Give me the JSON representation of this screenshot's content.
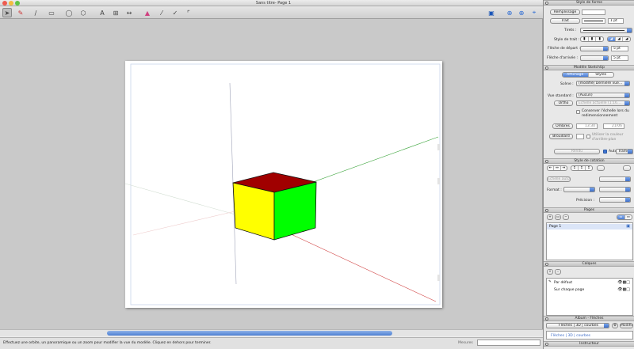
{
  "window": {
    "title": "Sans titre- Page 1"
  },
  "colors": {
    "close": "#ee5b50",
    "minimize": "#f2bc3f",
    "zoom": "#5fc546",
    "cube_top": "#a00000",
    "cube_left": "#ffff00",
    "cube_right": "#00ff00"
  },
  "toolbar": {
    "tools": [
      "select-arrow-icon",
      "pencil-icon",
      "line-icon",
      "rectangle-icon",
      "circle-icon",
      "polygon-icon",
      "text-icon",
      "label-icon",
      "dimension-icon",
      "eraser-icon",
      "eyedropper-icon",
      "paint-icon",
      "crop-icon"
    ],
    "right_tools": [
      "monitor-icon",
      "add-page-icon",
      "add-icon",
      "crosshair-icon"
    ]
  },
  "status": {
    "message": "Effectuez une orbite, un panoramique ou un zoom pour modifier la vue du modèle. Cliquez en dehors pour terminer.",
    "measures_label": "Mesures"
  },
  "inspector": {
    "style_forme": {
      "header": "Style de forme",
      "remplissage": "Remplissage",
      "trait": "Trait",
      "trait_size": "1 pt",
      "tirets_label": "Tirets :",
      "style_trait_label": "Style de trait :",
      "fleche_depart_label": "Flèche de départ :",
      "fleche_depart_size": "5 pt",
      "fleche_arrivee_label": "Flèche d'arrivée :",
      "fleche_arrivee_size": "5 pt"
    },
    "modele": {
      "header": "Modèle SketchUp",
      "tab_affichage": "Affichage",
      "tab_styles": "Styles",
      "scene_label": "Scène :",
      "scene_value": "(modifié) Dernière vue…",
      "vue_label": "Vue standard :",
      "vue_value": "(Aucun)",
      "ortho": "Ortho",
      "echelle": "Échelle actuelle (1:16…",
      "conserver": "Conserver l'échelle lors du redimensionnement",
      "ombres": "Ombres",
      "ombres_t1": "13:30",
      "ombres_t2": "21/06",
      "brouillard": "Brouillard",
      "utiliser": "Utiliser la couleur d'arrière-plan",
      "rendu": "Rendu",
      "auto": "Auto",
      "trame": "Tramé"
    },
    "cotation": {
      "header": "Style de cotation",
      "echelle_auto": "Échelle auto",
      "format_label": "Format :",
      "precision_label": "Précision :"
    },
    "pages": {
      "header": "Pages",
      "items": [
        "Page 1"
      ]
    },
    "calques": {
      "header": "Calques",
      "items": [
        "Par défaut",
        "Sur chaque page"
      ]
    },
    "album": {
      "header": "Album - Flèches",
      "select": "Flèches | 3D | courbes",
      "modifier": "Modifier...",
      "breadcrumb": "Flèches | 3D | courbes"
    },
    "instructeur": {
      "header": "Instructeur"
    }
  }
}
